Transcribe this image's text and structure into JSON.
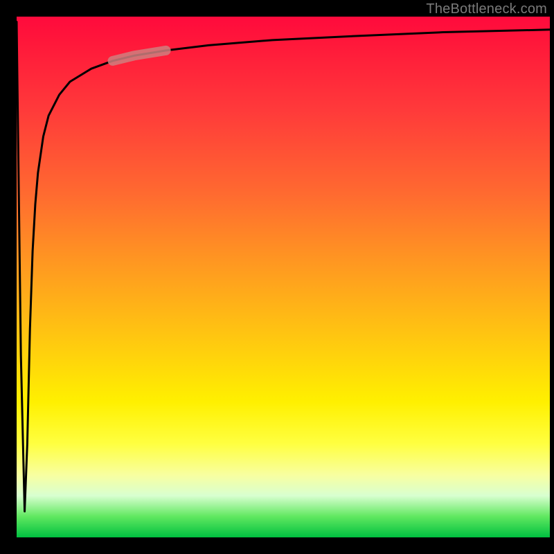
{
  "watermark": "TheBottleneck.com",
  "chart_data": {
    "type": "line",
    "title": "",
    "xlabel": "",
    "ylabel": "",
    "xlim": [
      0,
      100
    ],
    "ylim": [
      0,
      100
    ],
    "grid": false,
    "legend": false,
    "annotations": [],
    "background_gradient": {
      "direction": "vertical",
      "stops": [
        {
          "y": 100,
          "color": "#ff0a3c"
        },
        {
          "y": 82,
          "color": "#ff3a3a"
        },
        {
          "y": 66,
          "color": "#ff6a30"
        },
        {
          "y": 52,
          "color": "#ff9a20"
        },
        {
          "y": 38,
          "color": "#ffc810"
        },
        {
          "y": 26,
          "color": "#fff000"
        },
        {
          "y": 18,
          "color": "#ffff40"
        },
        {
          "y": 12,
          "color": "#f8ffa0"
        },
        {
          "y": 8,
          "color": "#d8ffd0"
        },
        {
          "y": 4,
          "color": "#60e860"
        },
        {
          "y": 0,
          "color": "#00c040"
        }
      ]
    },
    "x": [
      0,
      0.8,
      1.5,
      2,
      2.5,
      3,
      3.5,
      4,
      5,
      6,
      8,
      10,
      14,
      18,
      22,
      28,
      36,
      48,
      64,
      80,
      100
    ],
    "values": [
      99,
      35,
      5,
      18,
      40,
      55,
      64,
      70,
      77,
      81,
      85,
      87.5,
      90,
      91.5,
      92.5,
      93.5,
      94.5,
      95.5,
      96.3,
      97,
      97.5
    ],
    "highlight": {
      "x_range": [
        18,
        28
      ],
      "y_range": [
        91.5,
        93.5
      ],
      "color": "#cf7f7f",
      "opacity": 0.85
    }
  },
  "colors": {
    "curve": "#000000",
    "highlight": "#cf7f7f",
    "frame": "#000000",
    "watermark": "#7a7a7a"
  }
}
